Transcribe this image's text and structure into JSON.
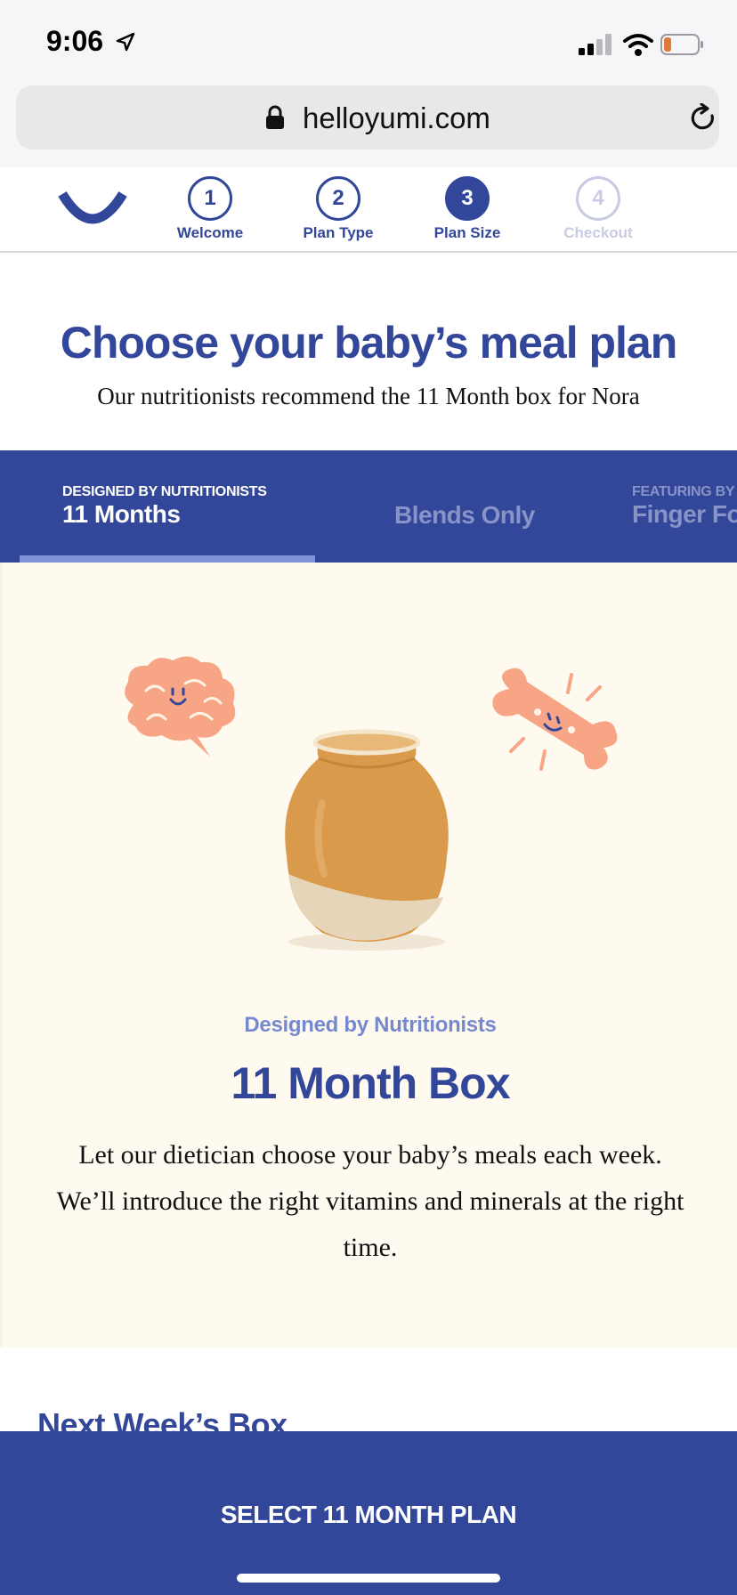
{
  "status_bar": {
    "time": "9:06"
  },
  "browser": {
    "url": "helloyumi.com"
  },
  "steps": [
    {
      "number": "1",
      "label": "Welcome",
      "state": "done"
    },
    {
      "number": "2",
      "label": "Plan Type",
      "state": "done"
    },
    {
      "number": "3",
      "label": "Plan Size",
      "state": "active"
    },
    {
      "number": "4",
      "label": "Checkout",
      "state": "disabled"
    }
  ],
  "header": {
    "title": "Choose your baby’s meal plan",
    "subtitle": "Our nutritionists recommend the 11 Month box for Nora"
  },
  "tabs": [
    {
      "kicker": "DESIGNED BY NUTRITIONISTS",
      "title": "11 Months",
      "selected": true
    },
    {
      "kicker": "",
      "title": "Blends Only",
      "selected": false
    },
    {
      "kicker": "FEATURING BY",
      "title": "Finger Fo",
      "selected": false
    }
  ],
  "card": {
    "kicker": "Designed by Nutritionists",
    "title": "11 Month Box",
    "description": "Let our dietician choose your baby’s meals each week. We’ll introduce the right vitamins and minerals at the right time."
  },
  "next_week": {
    "title": "Next Week’s Box"
  },
  "cta": {
    "label": "SELECT 11 MONTH PLAN"
  },
  "colors": {
    "brand_blue": "#33479a",
    "light_blue": "#7f93da",
    "card_bg": "#fffaf0",
    "illustration_peach": "#f7a584"
  },
  "icons": [
    "location-arrow-icon",
    "signal-icon",
    "wifi-icon",
    "battery-icon",
    "lock-icon",
    "reload-icon",
    "yumi-logo-icon",
    "brain-icon",
    "bone-icon"
  ]
}
